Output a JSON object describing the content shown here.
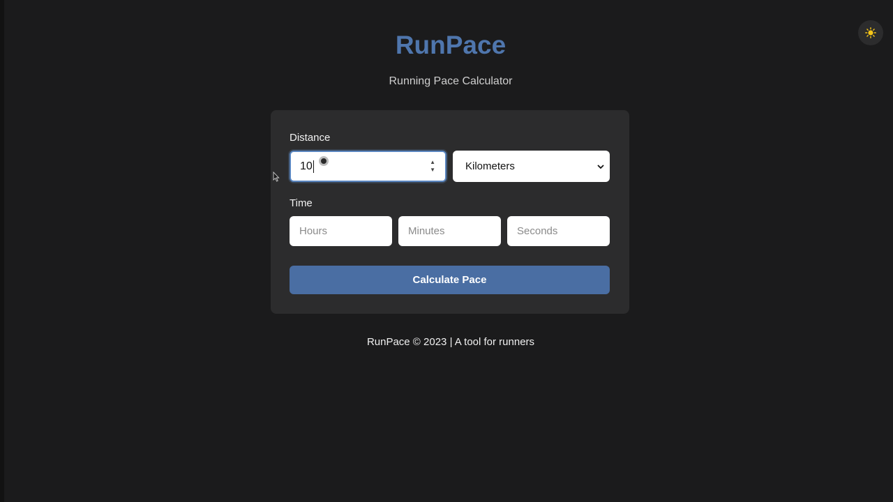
{
  "app": {
    "title": "RunPace",
    "subtitle": "Running Pace Calculator"
  },
  "theme_toggle": {
    "icon": "sun-icon",
    "color": "#f5c518"
  },
  "form": {
    "distance": {
      "label": "Distance",
      "value": "10",
      "unit_selected": "Kilometers"
    },
    "time": {
      "label": "Time",
      "hours_placeholder": "Hours",
      "minutes_placeholder": "Minutes",
      "seconds_placeholder": "Seconds"
    },
    "submit_label": "Calculate Pace"
  },
  "footer": {
    "text": "RunPace © 2023 | A tool for runners"
  },
  "colors": {
    "accent": "#4f76ad",
    "button": "#4a6ea3",
    "background": "#1b1b1c",
    "card": "#2c2c2d"
  }
}
